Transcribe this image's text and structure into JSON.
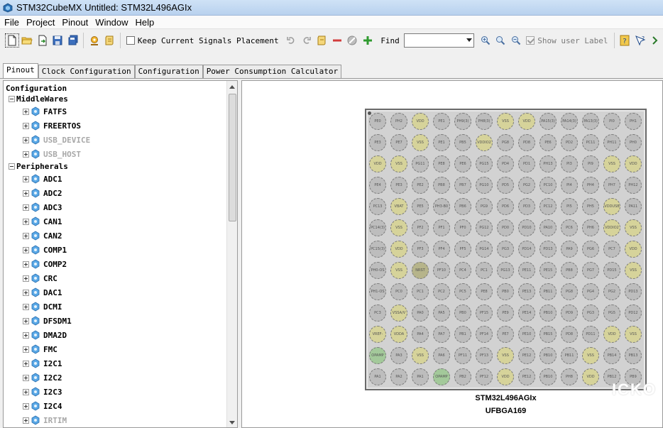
{
  "window": {
    "title": "STM32CubeMX Untitled: STM32L496AGIx"
  },
  "menu": [
    "File",
    "Project",
    "Pinout",
    "Window",
    "Help"
  ],
  "toolbar": {
    "keep_signals_label": "Keep Current Signals Placement",
    "find_label": "Find",
    "show_user_label": "Show user Label"
  },
  "tabs": [
    "Pinout",
    "Clock Configuration",
    "Configuration",
    "Power Consumption Calculator"
  ],
  "tree": {
    "root": "Configuration",
    "middlewares": {
      "label": "MiddleWares",
      "items": [
        {
          "label": "FATFS",
          "enabled": true
        },
        {
          "label": "FREERTOS",
          "enabled": true
        },
        {
          "label": "USB_DEVICE",
          "enabled": false
        },
        {
          "label": "USB_HOST",
          "enabled": false
        }
      ]
    },
    "peripherals": {
      "label": "Peripherals",
      "items": [
        {
          "label": "ADC1",
          "enabled": true
        },
        {
          "label": "ADC2",
          "enabled": true
        },
        {
          "label": "ADC3",
          "enabled": true
        },
        {
          "label": "CAN1",
          "enabled": true
        },
        {
          "label": "CAN2",
          "enabled": true
        },
        {
          "label": "COMP1",
          "enabled": true
        },
        {
          "label": "COMP2",
          "enabled": true
        },
        {
          "label": "CRC",
          "enabled": true
        },
        {
          "label": "DAC1",
          "enabled": true
        },
        {
          "label": "DCMI",
          "enabled": true
        },
        {
          "label": "DFSDM1",
          "enabled": true
        },
        {
          "label": "DMA2D",
          "enabled": true
        },
        {
          "label": "FMC",
          "enabled": true
        },
        {
          "label": "I2C1",
          "enabled": true
        },
        {
          "label": "I2C2",
          "enabled": true
        },
        {
          "label": "I2C3",
          "enabled": true
        },
        {
          "label": "I2C4",
          "enabled": true
        },
        {
          "label": "IRTIM",
          "enabled": false
        }
      ]
    }
  },
  "chip": {
    "part": "STM32L496AGIx",
    "package": "UFBGA169",
    "pins": [
      [
        "PE0",
        "PH2",
        "VDD",
        "PE1",
        "PH9(3)",
        "PH8(3)",
        "VSS",
        "VDD",
        "PA15(3)",
        "PA14(3)",
        "PA13(3)",
        "PI0",
        "PH1"
      ],
      [
        "PE3",
        "PE7",
        "VSS",
        "PE1",
        "PB5",
        "VDDIO2",
        "PG8",
        "PD8",
        "PE6",
        "PD2",
        "PC11",
        "PH11",
        "PH0"
      ],
      [
        "VDD",
        "VSS",
        "PG11",
        "PE8",
        "PE6",
        "PG15",
        "PD4",
        "PD1",
        "PH13",
        "PI3",
        "PI9",
        "VSS",
        "VDD"
      ],
      [
        "PE4",
        "PE3",
        "PE2",
        "PB8",
        "PB7",
        "PG10",
        "PD5",
        "PG2",
        "PC10",
        "PI4",
        "PH4",
        "PH7",
        "PH12"
      ],
      [
        "PC13",
        "VBAT",
        "PE5",
        "PH3-B0",
        "PB6",
        "PG9",
        "PD6",
        "PD3",
        "PC12",
        "PI5",
        "PH5",
        "VDDUSB",
        "PA11"
      ],
      [
        "PC14(3)",
        "VSS",
        "PF2",
        "PF1",
        "PF0",
        "PG12",
        "PD0",
        "PD10",
        "PA10",
        "PC6",
        "PH6",
        "VDDIO2",
        "VSS"
      ],
      [
        "PC15(3)",
        "VDD",
        "PF3",
        "PF4",
        "PF5",
        "PG14",
        "PG3",
        "PD14",
        "PD13",
        "PA9",
        "PG6",
        "PC7",
        "VDD"
      ],
      [
        "PH0-OS",
        "VSS",
        "NRST",
        "PF10",
        "PC4",
        "PC1",
        "PG13",
        "PE11",
        "PE15",
        "PB8",
        "PG7",
        "PD15",
        "VSS"
      ],
      [
        "PH1-OS",
        "PC0",
        "PC1",
        "PC2",
        "PC5",
        "PE8",
        "PB0",
        "PE13",
        "PB11",
        "PG8",
        "PG4",
        "PG2",
        "PD13"
      ],
      [
        "PC3",
        "VSSA/V",
        "PA0",
        "PA5",
        "PB0",
        "PF15",
        "PE9",
        "PE14",
        "PB10",
        "PD9",
        "PG3",
        "PG5",
        "PD12"
      ],
      [
        "VREF-",
        "VDDA",
        "PA4",
        "PA7",
        "PB1",
        "PF14",
        "PE7",
        "PE10",
        "PB15",
        "PD8",
        "PD11",
        "VDD",
        "VSS"
      ],
      [
        "OPAMP",
        "PA3",
        "VSS",
        "PA6",
        "PF11",
        "PF13",
        "VSS",
        "PE12",
        "PB10",
        "PB11",
        "VSS",
        "PB14",
        "PB13"
      ],
      [
        "PA1",
        "PA2",
        "PA1",
        "OPAMP",
        "PB2",
        "PF12",
        "VDD",
        "PE12",
        "PB10",
        "PH8",
        "VDD",
        "PB12",
        "PB9"
      ]
    ],
    "pin_colors": {
      "default": "#bdbdbd",
      "power": "#d6d39a",
      "reserved": "#b6b48a",
      "analog": "#a3c99a"
    }
  },
  "watermark": "ICKO"
}
